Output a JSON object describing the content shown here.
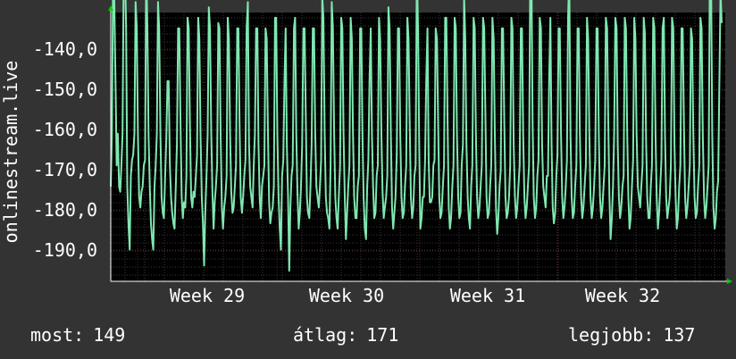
{
  "colors": {
    "background": "#333333",
    "plot_background": "#000000",
    "line": "#7fe7b0",
    "grid_major": "#5a1f1f",
    "grid_minor": "#3a3a3a",
    "axis": "#ffffff",
    "arrow": "#00cc00"
  },
  "chart_data": {
    "type": "line",
    "ylabel": "onlinestream.live",
    "ylim": [
      -198,
      -147
    ],
    "y_ticks": [
      "-140,0",
      "-150,0",
      "-160,0",
      "-170,0",
      "-180,0",
      "-190,0"
    ],
    "x_ticks": [
      "Week 29",
      "Week 30",
      "Week 31",
      "Week 32"
    ],
    "grid": true,
    "series": [
      {
        "values": [
          -180,
          -170,
          -140,
          -145,
          -160,
          -176,
          -170,
          -180,
          -181,
          -176,
          -170,
          -137,
          -138,
          -150,
          -180,
          -187,
          -192,
          -178,
          -175,
          -174,
          -170,
          -145,
          -150,
          -170,
          -182,
          -184,
          -181,
          -180,
          -176,
          -175,
          -138,
          -150,
          -170,
          -180,
          -187,
          -190,
          -192,
          -180,
          -176,
          -170,
          -145,
          -150,
          -170,
          -182,
          -185,
          -186,
          -178,
          -171,
          -160,
          -160,
          -176,
          -182,
          -185,
          -187,
          -188,
          -180,
          -172,
          -150,
          -150,
          -168,
          -182,
          -186,
          -183,
          -184,
          -178,
          -148,
          -150,
          -168,
          -182,
          -184,
          -181,
          -182,
          -178,
          -174,
          -148,
          -152,
          -170,
          -182,
          -187,
          -195,
          -185,
          -178,
          -170,
          -146,
          -150,
          -170,
          -181,
          -188,
          -183,
          -180,
          -176,
          -149,
          -150,
          -170,
          -184,
          -188,
          -184,
          -182,
          -178,
          -148,
          -152,
          -170,
          -181,
          -185,
          -184,
          -180,
          -176,
          -150,
          -150,
          -168,
          -182,
          -185,
          -182,
          -178,
          -175,
          -150,
          -145,
          -172,
          -180,
          -182,
          -184,
          -176,
          -170,
          -150,
          -150,
          -172,
          -182,
          -186,
          -180,
          -178,
          -176,
          -150,
          -152,
          -170,
          -183,
          -187,
          -185,
          -184,
          -180,
          -148,
          -148,
          -170,
          -182,
          -188,
          -192,
          -178,
          -175,
          -160,
          -150,
          -172,
          -182,
          -196,
          -184,
          -178,
          -176,
          -150,
          -148,
          -170,
          -181,
          -188,
          -185,
          -180,
          -172,
          -150,
          -150,
          -166,
          -182,
          -185,
          -186,
          -180,
          -172,
          -150,
          -150,
          -170,
          -180,
          -182,
          -184,
          -180,
          -175,
          -144,
          -148,
          -170,
          -182,
          -185,
          -186,
          -188,
          -176,
          -145,
          -150,
          -170,
          -182,
          -186,
          -188,
          -182,
          -176,
          -148,
          -150,
          -170,
          -182,
          -190,
          -185,
          -180,
          -176,
          -148,
          -152,
          -170,
          -182,
          -186,
          -186,
          -180,
          -178,
          -150,
          -150,
          -170,
          -182,
          -188,
          -190,
          -180,
          -175,
          -160,
          -150,
          -170,
          -180,
          -186,
          -185,
          -178,
          -176,
          -148,
          -152,
          -170,
          -181,
          -186,
          -184,
          -182,
          -178,
          -146,
          -150,
          -170,
          -184,
          -188,
          -185,
          -182,
          -174,
          -150,
          -150,
          -170,
          -182,
          -186,
          -185,
          -180,
          -176,
          -148,
          -152,
          -168,
          -182,
          -186,
          -184,
          -178,
          -176,
          -138,
          -150,
          -172,
          -188,
          -186,
          -182,
          -182,
          -175,
          -160,
          -150,
          -175,
          -183,
          -183,
          -182,
          -176,
          -175,
          -150,
          -152,
          -168,
          -182,
          -186,
          -185,
          -180,
          -176,
          -148,
          -148,
          -168,
          -184,
          -188,
          -186,
          -180,
          -176,
          -148,
          -150,
          -170,
          -182,
          -186,
          -185,
          -176,
          -172,
          -144,
          -152,
          -172,
          -182,
          -186,
          -188,
          -180,
          -176,
          -148,
          -150,
          -170,
          -182,
          -186,
          -184,
          -180,
          -176,
          -148,
          -150,
          -166,
          -182,
          -186,
          -185,
          -180,
          -176,
          -148,
          -152,
          -170,
          -184,
          -189,
          -186,
          -180,
          -177,
          -150,
          -150,
          -168,
          -182,
          -186,
          -185,
          -182,
          -176,
          -148,
          -150,
          -172,
          -182,
          -186,
          -184,
          -180,
          -176,
          -150,
          -150,
          -170,
          -182,
          -186,
          -184,
          -180,
          -176,
          -138,
          -140,
          -168,
          -182,
          -186,
          -184,
          -178,
          -175,
          -148,
          -150,
          -172,
          -180,
          -182,
          -184,
          -178,
          -178,
          -160,
          -148,
          -172,
          -184,
          -187,
          -185,
          -178,
          -174,
          -150,
          -150,
          -170,
          -182,
          -186,
          -184,
          -180,
          -175,
          -148,
          -140,
          -170,
          -182,
          -186,
          -185,
          -180,
          -176,
          -150,
          -150,
          -170,
          -182,
          -186,
          -184,
          -180,
          -176,
          -148,
          -152,
          -170,
          -182,
          -186,
          -184,
          -180,
          -175,
          -150,
          -150,
          -170,
          -182,
          -186,
          -184,
          -180,
          -176,
          -148,
          -150,
          -168,
          -182,
          -190,
          -186,
          -180,
          -170,
          -148,
          -150,
          -172,
          -182,
          -186,
          -184,
          -180,
          -178,
          -148,
          -150,
          -170,
          -182,
          -188,
          -186,
          -180,
          -175,
          -148,
          -152,
          -170,
          -180,
          -182,
          -184,
          -180,
          -176,
          -148,
          -151,
          -171,
          -182,
          -186,
          -186,
          -180,
          -176,
          -148,
          -150,
          -170,
          -182,
          -188,
          -185,
          -180,
          -175,
          -150,
          -148,
          -170,
          -182,
          -186,
          -184,
          -182,
          -176,
          -148,
          -150,
          -172,
          -182,
          -188,
          -186,
          -180,
          -176,
          -150,
          -150,
          -168,
          -182,
          -186,
          -184,
          -180,
          -176,
          -150,
          -152,
          -170,
          -182,
          -186,
          -185,
          -180,
          -176,
          -148,
          -150,
          -170,
          -182,
          -186,
          -184,
          -180,
          -176,
          -137,
          -140,
          -170,
          -184,
          -188,
          -186,
          -181,
          -179,
          -160,
          -143,
          -149
        ]
      }
    ]
  },
  "stats": {
    "most_label": "most:",
    "most_value": "149",
    "atlag_label": "átlag:",
    "atlag_value": "171",
    "legjobb_label": "legjobb:",
    "legjobb_value": "137"
  }
}
